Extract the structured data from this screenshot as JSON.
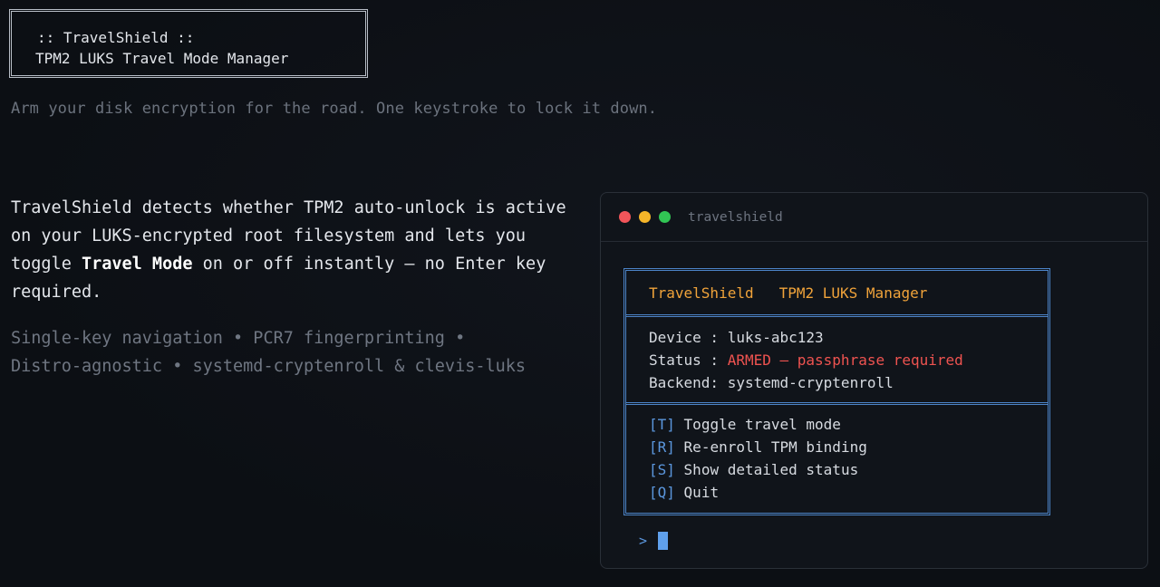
{
  "banner": {
    "line1": ":: TravelShield ::",
    "line2": "TPM2 LUKS Travel Mode Manager"
  },
  "tagline": "Arm your disk encryption for the road. One keystroke to lock it down.",
  "description": {
    "part1": "TravelShield detects whether TPM2 auto-unlock is active on your LUKS-encrypted root filesystem and lets you toggle ",
    "bold": "Travel Mode",
    "part2": " on or off instantly — no Enter key required."
  },
  "features": {
    "line1": "Single-key navigation • PCR7 fingerprinting •",
    "line2": "Distro-agnostic • systemd-cryptenroll & clevis-luks"
  },
  "terminal": {
    "title": "travelshield",
    "header_app": "TravelShield",
    "header_sub": "TPM2 LUKS Manager",
    "device_label": "Device : ",
    "device_value": "luks-abc123",
    "status_label": "Status : ",
    "status_value": "ARMED — passphrase required",
    "backend_label": "Backend: ",
    "backend_value": "systemd-cryptenroll",
    "menu": [
      {
        "key": "[T]",
        "label": "Toggle travel mode"
      },
      {
        "key": "[R]",
        "label": "Re-enroll TPM binding"
      },
      {
        "key": "[S]",
        "label": "Show detailed status"
      },
      {
        "key": "[Q]",
        "label": "Quit"
      }
    ],
    "prompt": ">"
  },
  "colors": {
    "accent_blue": "#4c84c8",
    "header_orange": "#f0a33a",
    "armed_red": "#ef5350"
  }
}
